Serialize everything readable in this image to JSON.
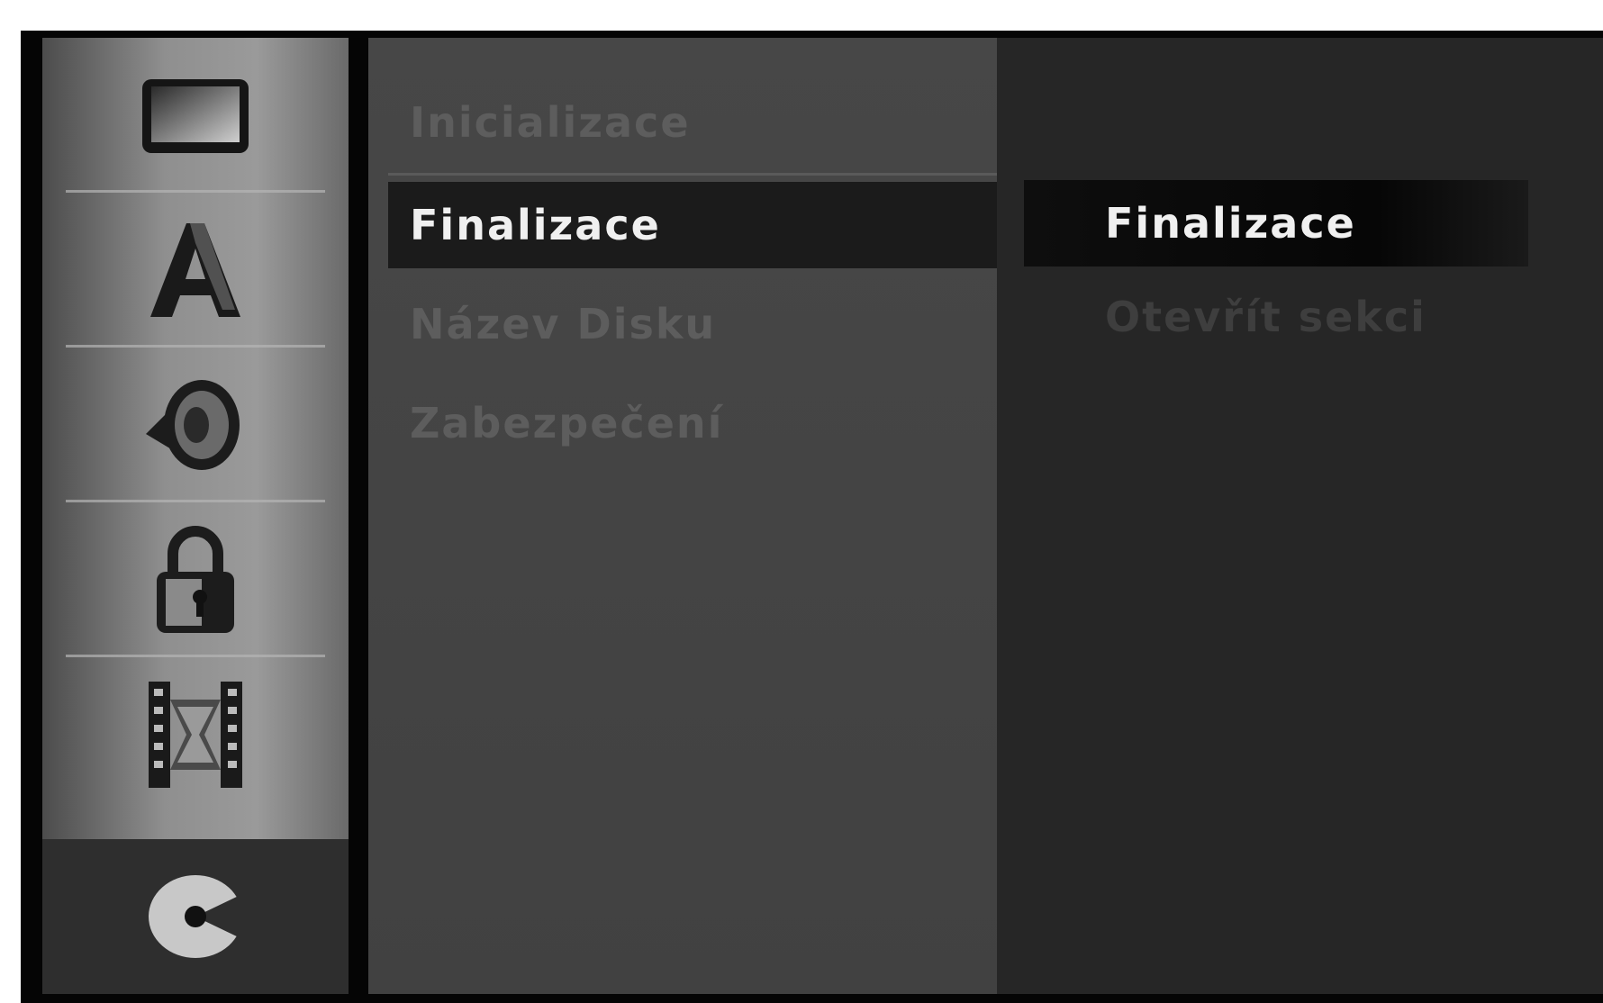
{
  "sidebar": {
    "items": [
      {
        "icon": "tv-screen-icon",
        "selected": false
      },
      {
        "icon": "letter-a-icon",
        "selected": false
      },
      {
        "icon": "speaker-icon",
        "selected": false
      },
      {
        "icon": "padlock-icon",
        "selected": false
      },
      {
        "icon": "film-reel-icon",
        "selected": false
      },
      {
        "icon": "disc-icon",
        "selected": true
      }
    ]
  },
  "menu": {
    "items": [
      {
        "label": "Inicializace",
        "selected": false
      },
      {
        "label": "Finalizace",
        "selected": true
      },
      {
        "label": "Název Disku",
        "selected": false
      },
      {
        "label": "Zabezpečení",
        "selected": false
      }
    ]
  },
  "options": {
    "items": [
      {
        "label": "Finalizace",
        "selected": true
      },
      {
        "label": "Otevřít sekci",
        "selected": false
      }
    ]
  },
  "colors": {
    "highlight_bg": "#1b1b1b",
    "highlight_text": "#f0f0f0",
    "dim_text": "#5d5d5d"
  }
}
